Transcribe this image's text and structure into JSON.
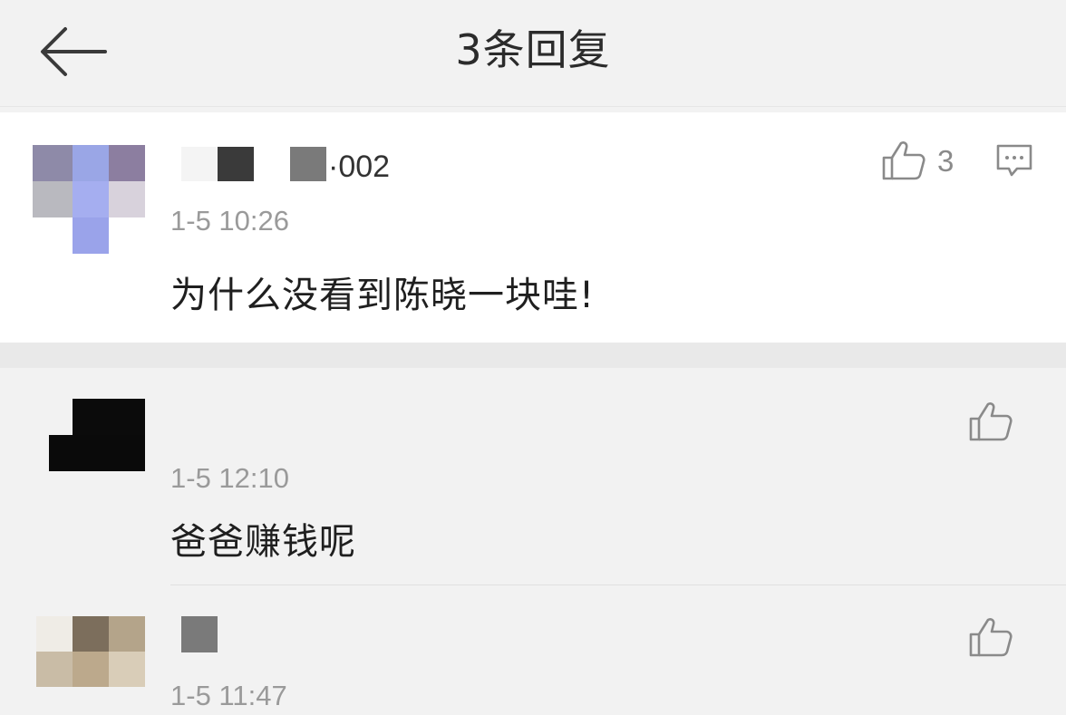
{
  "header": {
    "title": "3条回复",
    "back_icon": "back-arrow-icon"
  },
  "main_comment": {
    "username_visible_part": "·002",
    "timestamp": "1-5 10:26",
    "text": "为什么没看到陈晓一块哇!",
    "like_count": "3",
    "like_icon": "thumbs-up-icon",
    "reply_icon": "comment-bubble-icon"
  },
  "replies": [
    {
      "timestamp": "1-5 12:10",
      "text": "爸爸赚钱呢",
      "like_icon": "thumbs-up-icon"
    },
    {
      "timestamp": "1-5 11:47",
      "like_icon": "thumbs-up-icon"
    }
  ],
  "colors": {
    "background": "#f2f2f2",
    "main_card": "#ffffff",
    "timestamp": "#9a9a9a",
    "icon": "#8a8a8a"
  }
}
